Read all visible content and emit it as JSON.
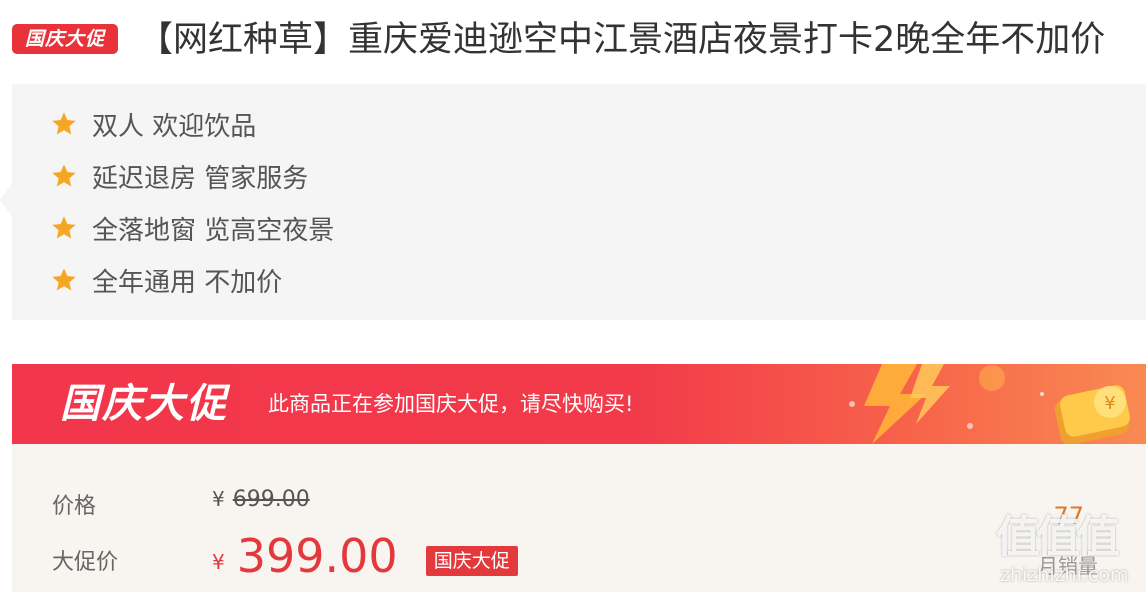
{
  "title": {
    "badge": "国庆大促",
    "text": "【网红种草】重庆爱迪逊空中江景酒店夜景打卡2晚全年不加价"
  },
  "features": {
    "icon": "star-icon",
    "icon_color": "#f5a623",
    "items": [
      "双人 欢迎饮品",
      "延迟退房 管家服务",
      "全落地窗 览高空夜景",
      "全年通用 不加价"
    ]
  },
  "banner": {
    "title": "国庆大促",
    "subtitle": "此商品正在参加国庆大促，请尽快购买!"
  },
  "price": {
    "original_label": "价格",
    "currency": "¥",
    "original_value": "699.00",
    "promo_label": "大促价",
    "promo_value": "399.00",
    "promo_tag": "国庆大促",
    "sales_count": "77",
    "sales_label": "月销量"
  },
  "watermark": {
    "glyphs": "值值值",
    "domain": "zhizhizhi.com"
  },
  "colors": {
    "accent_red": "#e4393c",
    "banner_red": "#f2364b",
    "star_orange": "#f5a623"
  }
}
